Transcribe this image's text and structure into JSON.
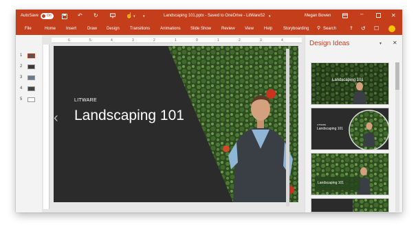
{
  "titlebar": {
    "autosave_label": "AutoSave",
    "autosave_state": "On",
    "doc_title": "Landscaping 101.pptx  -  Saved to OneDrive - LitWare52",
    "user": "Megan Bowen",
    "icons": [
      "save-icon",
      "undo-icon",
      "redo-icon",
      "present-icon",
      "touch-mode-icon",
      "customize-icon",
      "ribbon-display-icon",
      "minimize-icon",
      "maximize-icon",
      "close-icon"
    ]
  },
  "ribbon": {
    "tabs": [
      "File",
      "Home",
      "Insert",
      "Draw",
      "Design",
      "Transitions",
      "Animations",
      "Slide Show",
      "Review",
      "View",
      "Help",
      "Storyboarding"
    ],
    "search_label": "Search"
  },
  "thumbnails": {
    "numbers": [
      "1",
      "2",
      "3",
      "4",
      "5"
    ]
  },
  "slide": {
    "brand": "LITWARE",
    "title": "Landscaping 101"
  },
  "design_pane": {
    "title": "Design Ideas",
    "idea_titles": [
      "Landscaping 101",
      "Landscaping 101",
      "Landscaping 101"
    ],
    "idea_brand": "LITWARE"
  },
  "ruler": {
    "h_ticks": [
      "6",
      "5",
      "4",
      "3",
      "2",
      "1",
      "0",
      "1",
      "2",
      "3",
      "4"
    ]
  },
  "colors": {
    "accent": "#c43e1c",
    "slide_bg": "#2b2b2b",
    "foliage": "#2f4a22"
  }
}
